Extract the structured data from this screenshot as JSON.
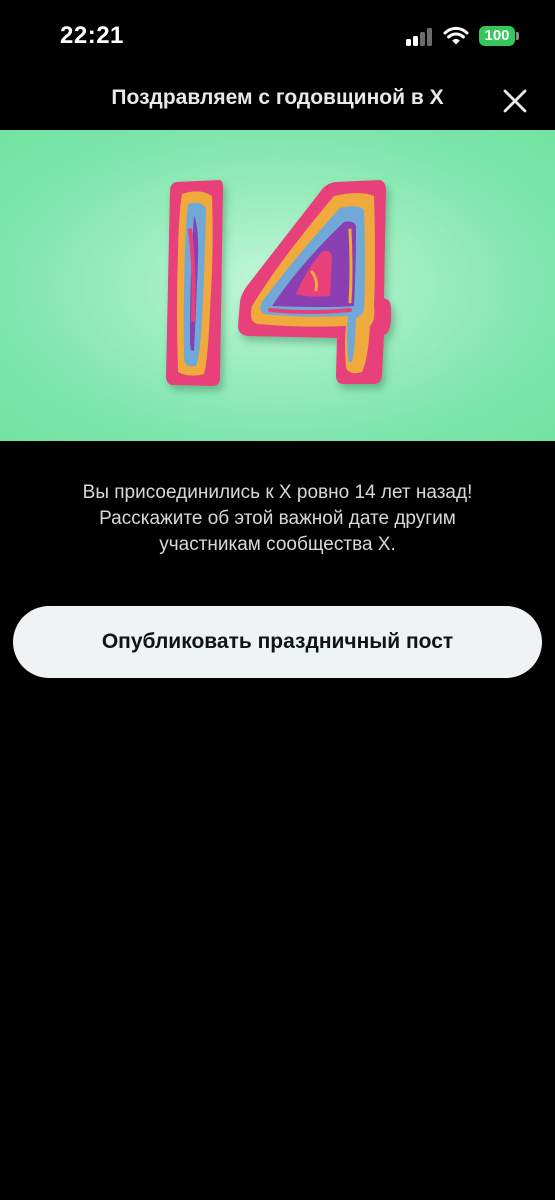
{
  "status_bar": {
    "time": "22:21",
    "battery_level": "100",
    "signal_icon": "cellular-signal-icon",
    "wifi_icon": "wifi-icon",
    "battery_color": "#34c759"
  },
  "header": {
    "title": "Поздравляем с годовщиной в X",
    "close_icon": "close-icon"
  },
  "hero": {
    "number": "14",
    "background_color": "#7fe6ac",
    "number_colors": [
      "#e8407a",
      "#f0a93c",
      "#6fa8d8",
      "#8a3fb2"
    ]
  },
  "message": {
    "lines": [
      "Вы присоединились к X ровно 14 лет назад!",
      "Расскажите об этой важной дате другим",
      "участникам сообщества X."
    ]
  },
  "actions": {
    "post_button_label": "Опубликовать праздничный пост"
  }
}
